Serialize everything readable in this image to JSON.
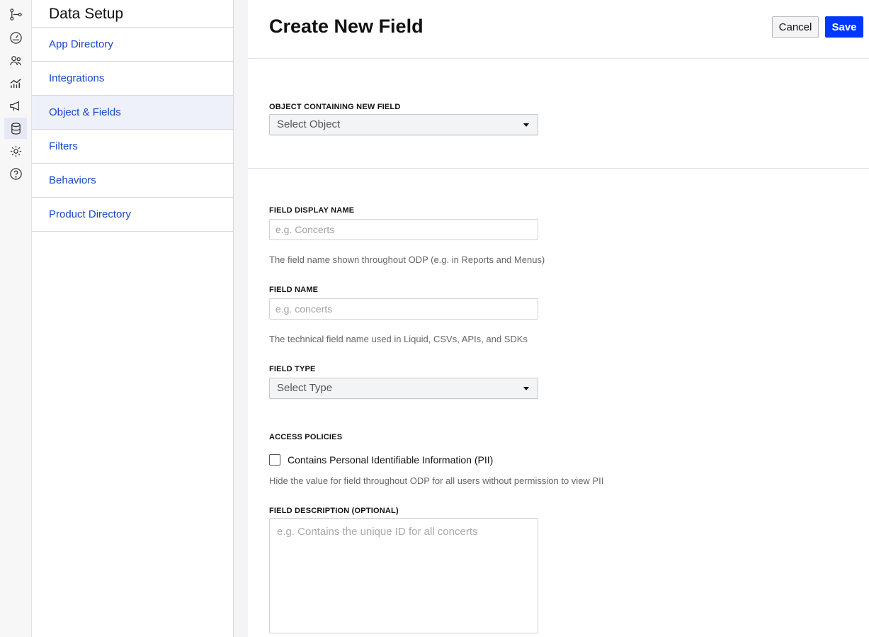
{
  "rail": {
    "icons": [
      {
        "name": "flow-icon",
        "active": false
      },
      {
        "name": "gauge-icon",
        "active": false
      },
      {
        "name": "users-icon",
        "active": false
      },
      {
        "name": "analytics-icon",
        "active": false
      },
      {
        "name": "megaphone-icon",
        "active": false
      },
      {
        "name": "database-icon",
        "active": true
      },
      {
        "name": "gear-icon",
        "active": false
      },
      {
        "name": "help-icon",
        "active": false
      }
    ]
  },
  "subnav": {
    "title": "Data Setup",
    "items": [
      {
        "label": "App Directory",
        "active": false
      },
      {
        "label": "Integrations",
        "active": false
      },
      {
        "label": "Object & Fields",
        "active": true
      },
      {
        "label": "Filters",
        "active": false
      },
      {
        "label": "Behaviors",
        "active": false
      },
      {
        "label": "Product Directory",
        "active": false
      }
    ]
  },
  "header": {
    "title": "Create New Field",
    "cancel_label": "Cancel",
    "save_label": "Save"
  },
  "form": {
    "object": {
      "label": "OBJECT CONTAINING NEW FIELD",
      "selected": "Select Object"
    },
    "display_name": {
      "label": "FIELD DISPLAY NAME",
      "value": "",
      "placeholder": "e.g. Concerts",
      "help": "The field name shown throughout ODP (e.g. in Reports and Menus)"
    },
    "field_name": {
      "label": "FIELD NAME",
      "value": "",
      "placeholder": "e.g. concerts",
      "help": "The technical field name used in Liquid, CSVs, APIs, and SDKs"
    },
    "field_type": {
      "label": "FIELD TYPE",
      "selected": "Select Type"
    },
    "access": {
      "label": "ACCESS POLICIES",
      "checkbox_label": "Contains Personal Identifiable Information (PII)",
      "checked": false,
      "help": "Hide the value for field throughout ODP for all users without permission to view PII"
    },
    "description": {
      "label": "FIELD DESCRIPTION (OPTIONAL)",
      "value": "",
      "placeholder": "e.g. Contains the unique ID for all concerts"
    }
  },
  "colors": {
    "accent": "#0037ff",
    "link": "#1746c4",
    "active_bg": "#eef0fa"
  }
}
